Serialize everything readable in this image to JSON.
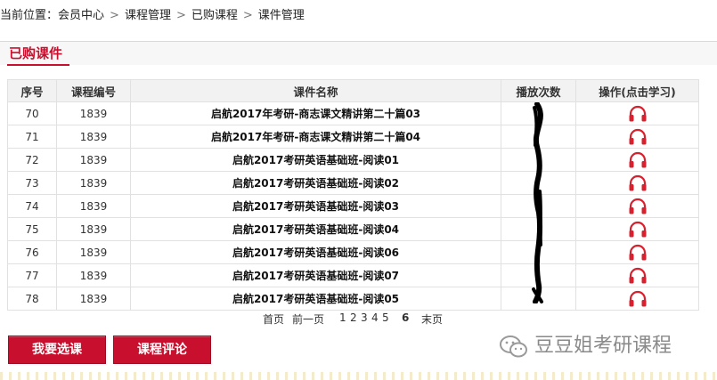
{
  "breadcrumb": {
    "prefix": "当前位置：",
    "items": [
      "会员中心",
      "课程管理",
      "已购课程",
      "课件管理"
    ],
    "separator": ">"
  },
  "panel": {
    "title": "已购课件"
  },
  "table": {
    "headers": [
      "序号",
      "课程编号",
      "课件名称",
      "播放次数",
      "操作(点击学习)"
    ],
    "rows": [
      {
        "no": "70",
        "code": "1839",
        "name": "启航2017年考研-商志课文精讲第二十篇03"
      },
      {
        "no": "71",
        "code": "1839",
        "name": "启航2017年考研-商志课文精讲第二十篇04"
      },
      {
        "no": "72",
        "code": "1839",
        "name": "启航2017考研英语基础班-阅读01"
      },
      {
        "no": "73",
        "code": "1839",
        "name": "启航2017考研英语基础班-阅读02"
      },
      {
        "no": "74",
        "code": "1839",
        "name": "启航2017考研英语基础班-阅读03"
      },
      {
        "no": "75",
        "code": "1839",
        "name": "启航2017考研英语基础班-阅读04"
      },
      {
        "no": "76",
        "code": "1839",
        "name": "启航2017考研英语基础班-阅读06"
      },
      {
        "no": "77",
        "code": "1839",
        "name": "启航2017考研英语基础班-阅读07"
      },
      {
        "no": "78",
        "code": "1839",
        "name": "启航2017考研英语基础班-阅读05"
      }
    ]
  },
  "pager": {
    "first": "首页",
    "prev": "前一页",
    "pages": [
      "1",
      "2",
      "3",
      "4",
      "5",
      "6"
    ],
    "current": "6",
    "last": "末页"
  },
  "buttons": {
    "choose_course": "我要选课",
    "course_review": "课程评论"
  },
  "watermark": {
    "text": "豆豆姐考研课程"
  },
  "colors": {
    "accent": "#c8102e",
    "icon": "#d8202e",
    "header_bg": "#f2f2f2"
  },
  "icons": {
    "operation": "headphones-icon",
    "watermark": "wechat-icon"
  }
}
